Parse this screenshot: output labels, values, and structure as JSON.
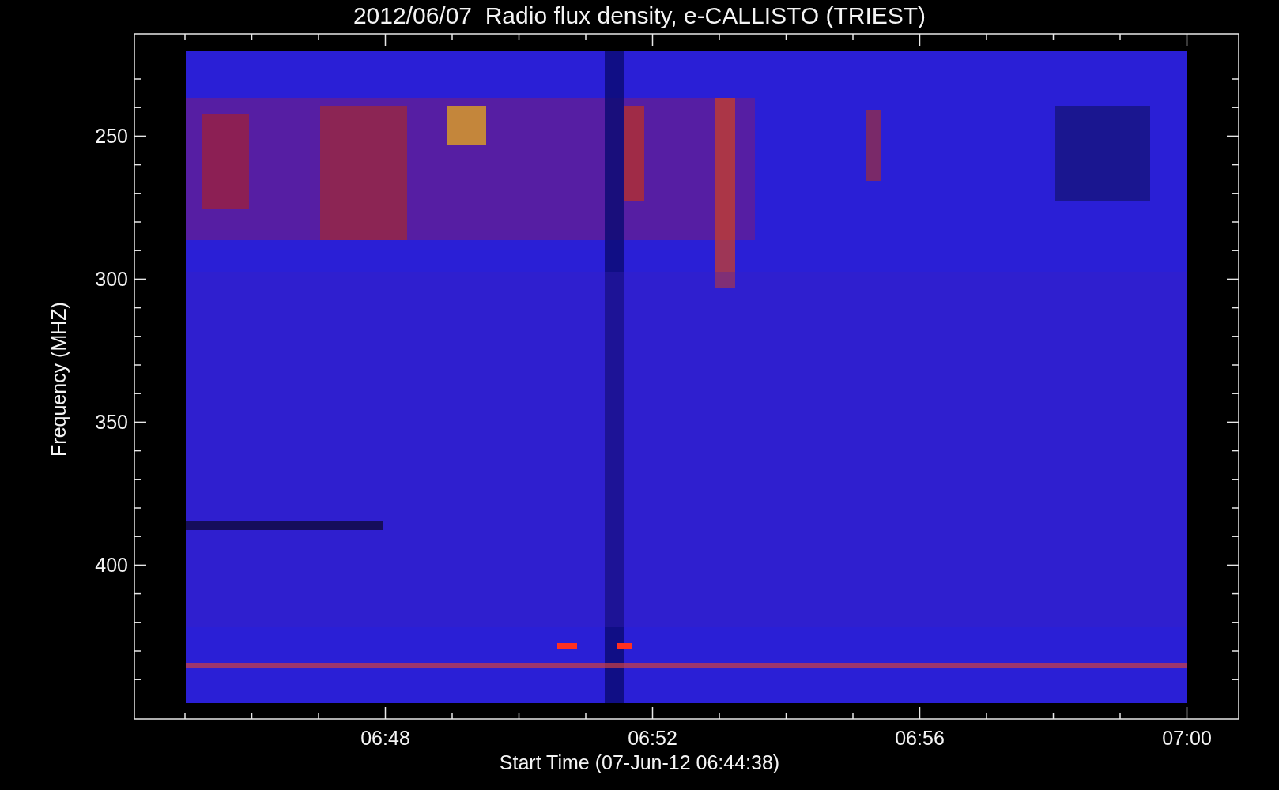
{
  "title": "2012/06/07  Radio flux density, e-CALLISTO (TRIEST)",
  "y_axis": {
    "label": "Frequency (MHZ)",
    "ticks": [
      "250",
      "300",
      "350",
      "400"
    ]
  },
  "x_axis": {
    "label": "Start Time (07-Jun-12 06:44:38)",
    "ticks": [
      "06:48",
      "06:52",
      "06:56",
      "07:00"
    ]
  }
}
